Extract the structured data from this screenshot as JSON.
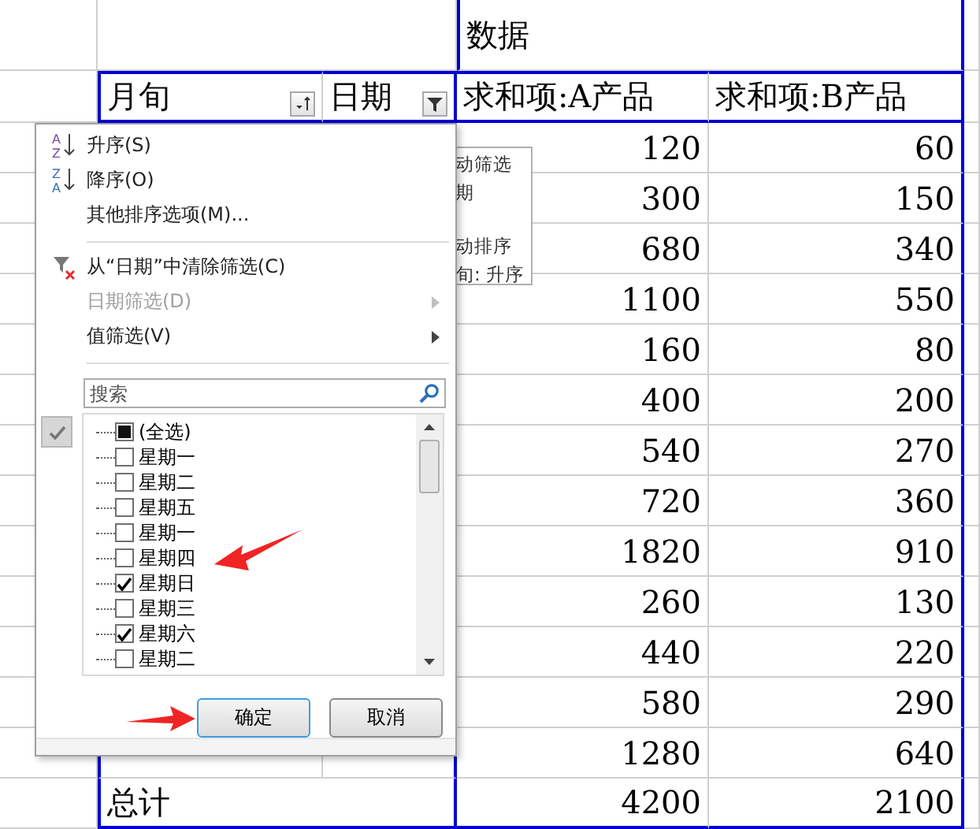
{
  "sheet": {
    "data_title": "数据",
    "headers": [
      {
        "label": "月旬",
        "kind": "sort"
      },
      {
        "label": "日期",
        "kind": "filter"
      },
      {
        "label": "求和项:A产品"
      },
      {
        "label": "求和项:B产品"
      }
    ],
    "rows": [
      {
        "a": "120",
        "b": "60"
      },
      {
        "a": "300",
        "b": "150"
      },
      {
        "a": "680",
        "b": "340"
      },
      {
        "a": "1100",
        "b": "550"
      },
      {
        "a": "160",
        "b": "80"
      },
      {
        "a": "400",
        "b": "200"
      },
      {
        "a": "540",
        "b": "270"
      },
      {
        "a": "720",
        "b": "360"
      },
      {
        "a": "1820",
        "b": "910"
      },
      {
        "a": "260",
        "b": "130"
      },
      {
        "a": "440",
        "b": "220"
      },
      {
        "a": "580",
        "b": "290"
      },
      {
        "a": "1280",
        "b": "640"
      },
      {
        "label": "总计",
        "a": "4200",
        "b": "2100"
      }
    ]
  },
  "tooltip": {
    "sections": [
      [
        "动筛选",
        "期"
      ],
      [
        "动排序",
        "旬: 升序"
      ]
    ]
  },
  "menu": {
    "items": [
      {
        "kind": "asc",
        "icon_letters": [
          "A",
          "Z"
        ],
        "label": "升序(S)",
        "disabled": false,
        "submenu": false
      },
      {
        "kind": "desc",
        "icon_letters": [
          "Z",
          "A"
        ],
        "label": "降序(O)",
        "disabled": false,
        "submenu": false
      },
      {
        "kind": "plain",
        "label": "其他排序选项(M)...",
        "disabled": false,
        "submenu": false
      },
      {
        "kind": "separator"
      },
      {
        "kind": "clear",
        "label": "从“日期”中清除筛选(C)",
        "disabled": false,
        "submenu": false
      },
      {
        "kind": "plain",
        "label": "日期筛选(D)",
        "disabled": true,
        "submenu": true
      },
      {
        "kind": "plain",
        "label": "值筛选(V)",
        "disabled": false,
        "submenu": true
      },
      {
        "kind": "separator"
      }
    ],
    "search": {
      "placeholder": "搜索"
    },
    "select_all": {
      "label": "(全选)",
      "indeterminate": true
    },
    "list": [
      {
        "label": "星期一",
        "checked": false
      },
      {
        "label": "星期二",
        "checked": false
      },
      {
        "label": "星期五",
        "checked": false
      },
      {
        "label": "星期一",
        "checked": false
      },
      {
        "label": "星期四",
        "checked": false
      },
      {
        "label": "星期日",
        "checked": true
      },
      {
        "label": "星期三",
        "checked": false
      },
      {
        "label": "星期六",
        "checked": true
      },
      {
        "label": "星期二",
        "checked": false
      }
    ],
    "buttons": [
      {
        "label": "确定",
        "selected": true
      },
      {
        "label": "取消",
        "selected": false
      }
    ]
  }
}
